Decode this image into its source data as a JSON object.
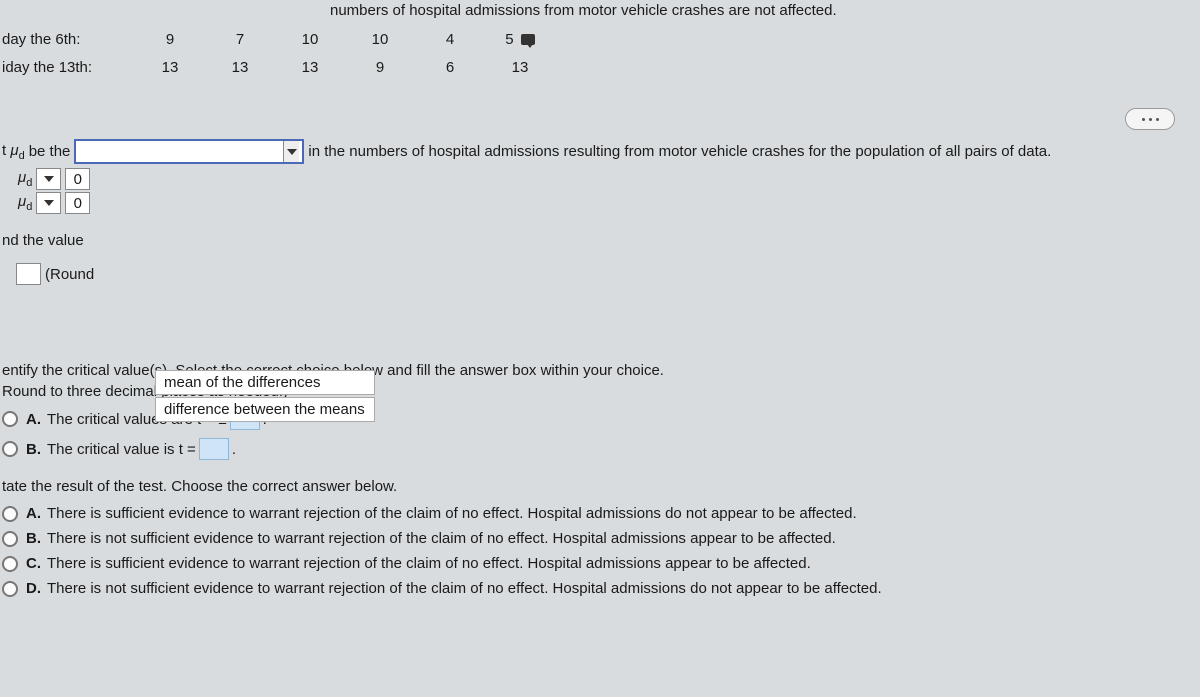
{
  "top_text": "numbers of hospital admissions from motor vehicle crashes are not affected.",
  "table": {
    "row1_label": "day the 6th:",
    "row2_label": "iday the 13th:",
    "row1": [
      "9",
      "7",
      "10",
      "10",
      "4",
      "5"
    ],
    "row2": [
      "13",
      "13",
      "13",
      "9",
      "6",
      "13"
    ]
  },
  "q_mud": {
    "prefix": "t μ",
    "sub": "d",
    "mid": " be the",
    "after": " in the numbers of hospital admissions resulting from motor vehicle crashes for the population of all pairs of data."
  },
  "hyp1_label": ": μ",
  "hyp1_sub": "d",
  "hyp1_val": "0",
  "hyp2_label": ": μ",
  "hyp2_sub": "d",
  "hyp2_val": "0",
  "value_label": "nd the value",
  "round_label": "(Round",
  "dd_opt1": "mean of the differences",
  "dd_opt2": "difference between the means",
  "critical": {
    "instr1": "entify the critical value(s). Select the correct choice below and fill the answer box within your choice.",
    "instr2": "Round to three decimal places as needed.)",
    "a_letter": "A.",
    "a_text": "The critical values are t = ±",
    "a_suffix": ".",
    "b_letter": "B.",
    "b_text": "The critical value is t =",
    "b_suffix": "."
  },
  "result": {
    "instr": "tate the result of the test. Choose the correct answer below.",
    "a_letter": "A.",
    "a_text": "There is sufficient evidence to warrant rejection of the claim of no effect. Hospital admissions do not appear to be affected.",
    "b_letter": "B.",
    "b_text": "There is not sufficient evidence to warrant rejection of the claim of no effect. Hospital admissions appear to be affected.",
    "c_letter": "C.",
    "c_text": "There is sufficient evidence to warrant rejection of the claim of no effect. Hospital admissions appear to be affected.",
    "d_letter": "D.",
    "d_text": "There is not sufficient evidence to warrant rejection of the claim of no effect. Hospital admissions do not appear to be affected."
  }
}
